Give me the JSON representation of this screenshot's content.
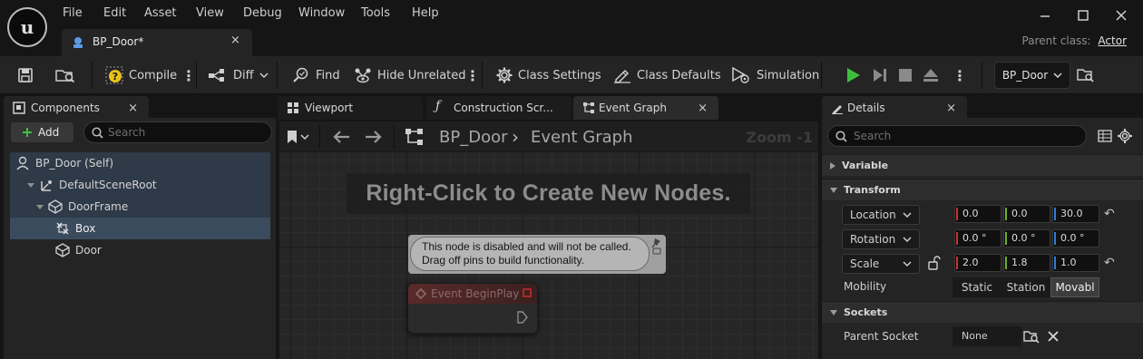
{
  "menu": {
    "items": [
      "File",
      "Edit",
      "Asset",
      "View",
      "Debug",
      "Window",
      "Tools",
      "Help"
    ]
  },
  "document_tab": {
    "label": "BP_Door*",
    "close": "×"
  },
  "parent_class": {
    "label": "Parent class:",
    "value": "Actor"
  },
  "toolbar": {
    "compile": "Compile",
    "diff": "Diff",
    "find": "Find",
    "hide_unrelated": "Hide Unrelated",
    "class_settings": "Class Settings",
    "class_defaults": "Class Defaults",
    "simulation": "Simulation",
    "debug_object": "BP_Door"
  },
  "components_panel": {
    "tab_label": "Components",
    "add_label": "Add",
    "search_placeholder": "Search",
    "tree": [
      {
        "label": "BP_Door (Self)",
        "icon": "actor-icon"
      },
      {
        "label": "DefaultSceneRoot",
        "icon": "scene-root-icon"
      },
      {
        "label": "DoorFrame",
        "icon": "static-mesh-icon"
      },
      {
        "label": "Box",
        "icon": "box-collision-icon"
      },
      {
        "label": "Door",
        "icon": "static-mesh-icon"
      }
    ]
  },
  "editor_tabs": {
    "viewport": "Viewport",
    "construction_script": "Construction Scr...",
    "event_graph": "Event Graph"
  },
  "graph": {
    "breadcrumb_bp": "BP_Door",
    "breadcrumb_sep": "›",
    "breadcrumb_graph": "Event Graph",
    "zoom": "Zoom -1",
    "hint": "Right-Click to Create New Nodes.",
    "comment_line1": "This node is disabled and will not be called.",
    "comment_line2": "Drag off pins to build functionality.",
    "event_node_title": "Event BeginPlay"
  },
  "details_panel": {
    "tab_label": "Details",
    "search_placeholder": "Search",
    "sections": {
      "variable": "Variable",
      "transform": "Transform",
      "sockets": "Sockets"
    },
    "transform": {
      "location": {
        "label": "Location",
        "x": "0.0",
        "y": "0.0",
        "z": "30.0"
      },
      "rotation": {
        "label": "Rotation",
        "x": "0.0 °",
        "y": "0.0 °",
        "z": "0.0 °"
      },
      "scale": {
        "label": "Scale",
        "x": "2.0",
        "y": "1.8",
        "z": "1.0"
      }
    },
    "mobility": {
      "label": "Mobility",
      "options": [
        "Static",
        "Station",
        "Movabl"
      ],
      "selected": "Movabl"
    },
    "parent_socket": {
      "label": "Parent Socket",
      "value": "None"
    }
  },
  "colors": {
    "play_green": "#3fbf3f",
    "axis_x": "#c7342d",
    "axis_y": "#6fac2a",
    "axis_z": "#2f7dd8",
    "selection": "#3a4b5e"
  }
}
